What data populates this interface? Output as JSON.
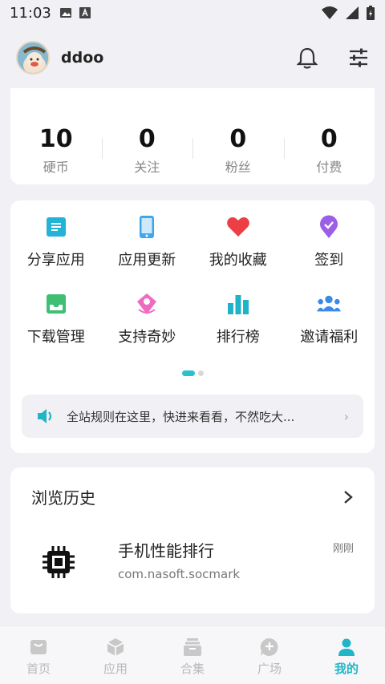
{
  "status_bar": {
    "time": "11:03"
  },
  "profile": {
    "username": "ddoo"
  },
  "stats": [
    {
      "value": "10",
      "label": "硬币"
    },
    {
      "value": "0",
      "label": "关注"
    },
    {
      "value": "0",
      "label": "粉丝"
    },
    {
      "value": "0",
      "label": "付费"
    }
  ],
  "tools": [
    {
      "label": "分享应用",
      "icon": "share-app-icon",
      "color": "#23b3d6"
    },
    {
      "label": "应用更新",
      "icon": "phone-update-icon",
      "color": "#3ca6ee"
    },
    {
      "label": "我的收藏",
      "icon": "heart-icon",
      "color": "#ec3e44"
    },
    {
      "label": "签到",
      "icon": "checkin-badge-icon",
      "color": "#9b5ee6"
    },
    {
      "label": "下载管理",
      "icon": "download-tray-icon",
      "color": "#3fbf74"
    },
    {
      "label": "支持奇妙",
      "icon": "support-tag-icon",
      "color": "#ef6ac0"
    },
    {
      "label": "排行榜",
      "icon": "ranking-bars-icon",
      "color": "#20b2c7"
    },
    {
      "label": "邀请福利",
      "icon": "invite-people-icon",
      "color": "#3a8be8"
    }
  ],
  "notice": {
    "text": "全站规则在这里，快进来看看，不然吃大..."
  },
  "history": {
    "title": "浏览历史",
    "item": {
      "name": "手机性能排行",
      "package": "com.nasoft.socmark",
      "time": "刚刚"
    }
  },
  "tabs": [
    {
      "label": "首页",
      "icon": "home-icon",
      "active": false
    },
    {
      "label": "应用",
      "icon": "apps-cube-icon",
      "active": false
    },
    {
      "label": "合集",
      "icon": "collection-box-icon",
      "active": false
    },
    {
      "label": "广场",
      "icon": "square-chat-icon",
      "active": false
    },
    {
      "label": "我的",
      "icon": "profile-icon",
      "active": true
    }
  ],
  "colors": {
    "accent": "#21b5c6",
    "background": "#f1f1f5"
  }
}
